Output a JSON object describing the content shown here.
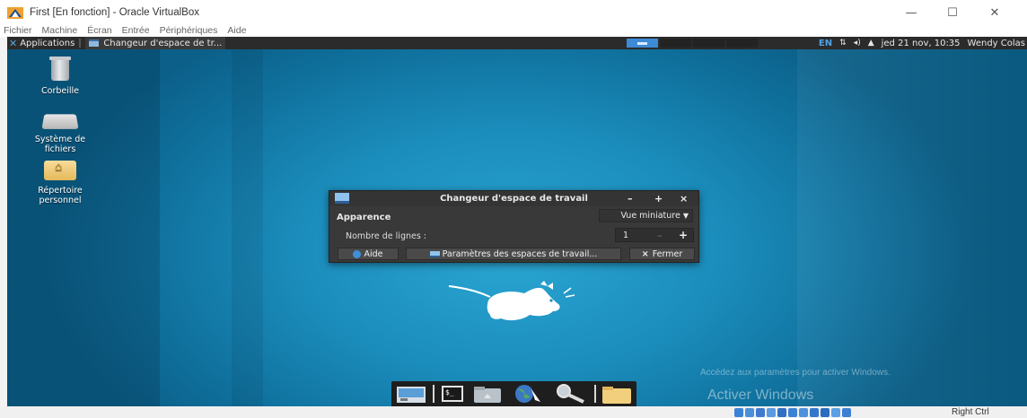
{
  "vbox": {
    "window_title": "First [En fonction] - Oracle VirtualBox",
    "controls": {
      "minimize": "—",
      "maximize": "☐",
      "close": "✕"
    },
    "menu": [
      "Fichier",
      "Machine",
      "Écran",
      "Entrée",
      "Périphériques",
      "Aide"
    ],
    "status_bar": {
      "host_key": "Right Ctrl"
    }
  },
  "panel": {
    "applications_label": "Applications",
    "task_label": "Changeur d'espace de tr...",
    "tray": {
      "keyboard_layout": "EN",
      "clock": "jed 21 nov, 10:35",
      "user": "Wendy Colas"
    }
  },
  "desktop": {
    "icons": [
      {
        "label": "Corbeille"
      },
      {
        "label": "Système de fichiers"
      },
      {
        "label": "Répertoire personnel"
      }
    ]
  },
  "dialog": {
    "title": "Changeur d'espace de travail",
    "controls": {
      "minimize": "–",
      "maximize": "+",
      "close": "×"
    },
    "appearance_label": "Apparence",
    "view_mode": "Vue miniature",
    "rows_label": "Nombre de lignes :",
    "rows_value": "1",
    "rows_minus": "–",
    "rows_plus": "+",
    "help_button": "Aide",
    "settings_button": "Paramètres des espaces de travail...",
    "close_button": "Fermer",
    "close_glyph": "×"
  },
  "watermark": {
    "title": "Activer Windows",
    "subtitle": "Accédez aux paramètres pour activer Windows."
  },
  "colors": {
    "panel_bg": "#2b2b2b",
    "accent_blue": "#3d8ad6",
    "desktop_blue": "#1b8dbc",
    "dialog_bg": "#393939"
  }
}
